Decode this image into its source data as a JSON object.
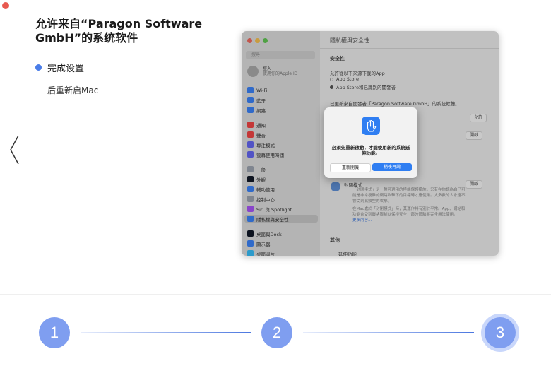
{
  "page": {
    "title": "允许来自“Paragon Software GmbH”的系统软件",
    "step_label": "完成设置",
    "description": "后重新启Mac"
  },
  "mac_window": {
    "title": "隱私權與安全性",
    "search_placeholder": "搜尋",
    "user": {
      "name": "登入",
      "sub": "使用你的Apple ID"
    },
    "sidebar_items": [
      "Wi-Fi",
      "藍牙",
      "網路",
      "通知",
      "聲音",
      "專注模式",
      "螢幕使用時間",
      "一般",
      "外觀",
      "輔助使用",
      "控制中心",
      "Siri 與 Spotlight",
      "隱私權與安全性",
      "桌面與Dock",
      "顯示器",
      "桌面圖片"
    ],
    "security_heading": "安全性",
    "allow_text": "允許從以下來源下載的App",
    "radio_1": "App Store",
    "radio_2": "App Store和已識別的開發者",
    "blocked_text": "已更新來自開發者「Paragon Software GmbH」的系統軟體。",
    "allow_button": "允許",
    "open_button_1": "開啟",
    "lockdown_title": "封閉模式",
    "lockdown_desc": "「封閉模式」是一種可選用的極端保護措施，只有在你認為自己可能是非常複雜的網路攻擊下的目標時才應使用。大多數的人永遠不會受到此類型的攻擊。",
    "lockdown_desc_2": "在Mac處於「封閉模式」時，其運作將有別於平常。App、網站和功能會受到嚴格限制以保持安全，部分體驗將完全無法使用。",
    "learn_more": "更多內容…",
    "open_button_2": "開啟",
    "other_heading": "其他",
    "extensions_label": "延伸功能"
  },
  "dialog": {
    "message": "必須先重新啟動，才能使用新的系統延伸功能。",
    "restart_button": "重新開機",
    "later_button": "稍後再說"
  },
  "stepper": {
    "steps": [
      "1",
      "2",
      "3"
    ],
    "active_step": 3
  },
  "colors": {
    "accent": "#4a7de8",
    "step_circle": "#7f9ef0",
    "mac_blue": "#2f7ef2"
  }
}
